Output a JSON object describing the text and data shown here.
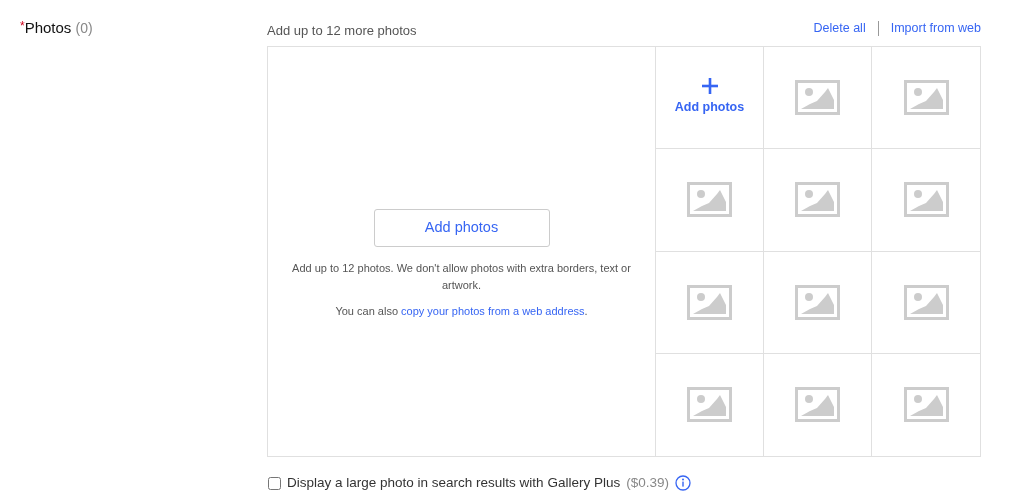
{
  "field": {
    "required_mark": "*",
    "label": "Photos",
    "count": "(0)"
  },
  "header": {
    "hint": "Add up to 12 more photos",
    "links": [
      "Delete all",
      "Import from web"
    ]
  },
  "dropzone": {
    "button": "Add photos",
    "rules": "Add up to 12 photos. We don't allow photos with extra borders, text or artwork.",
    "note_prefix": "You can also",
    "note_link": "copy your photos from a web address",
    "note_suffix": "."
  },
  "slots": [
    {
      "kind": "add",
      "label": "Add photos"
    },
    {
      "kind": "empty"
    },
    {
      "kind": "empty"
    },
    {
      "kind": "empty"
    },
    {
      "kind": "empty"
    },
    {
      "kind": "empty"
    },
    {
      "kind": "empty"
    },
    {
      "kind": "empty"
    },
    {
      "kind": "empty"
    },
    {
      "kind": "empty"
    },
    {
      "kind": "empty"
    },
    {
      "kind": "empty"
    }
  ],
  "gallery_option": {
    "checked": false,
    "label": "Display a large photo in search results with Gallery Plus",
    "price": "($0.39)"
  }
}
